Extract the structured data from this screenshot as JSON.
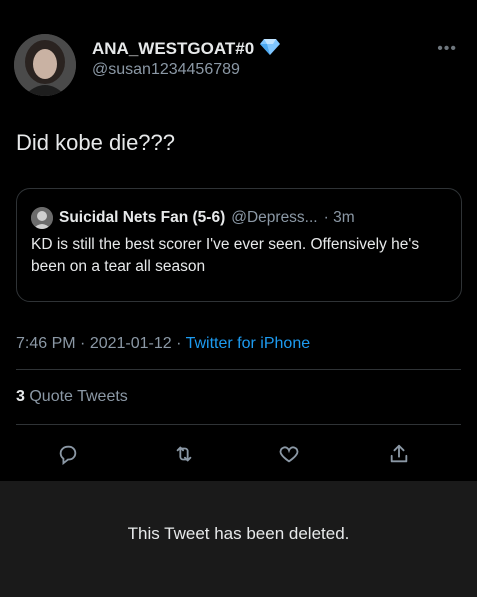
{
  "tweet": {
    "display_name": "ANA_WESTGOAT#0",
    "handle": "@susan1234456789",
    "more_icon": "more-dots-icon",
    "verified_icon": "diamond-icon",
    "text": "Did kobe die???",
    "quoted": {
      "name": "Suicidal Nets Fan (5-6)",
      "handle": "@Depress...",
      "time": "· 3m",
      "body": "KD is still the best scorer I've ever seen. Offensively he's been on a tear all season"
    },
    "meta": {
      "time": "7:46 PM",
      "date": "2021-01-12",
      "source": "Twitter for iPhone"
    },
    "quote_tweets": {
      "count": "3",
      "label": "Quote Tweets"
    }
  },
  "actions": [
    "reply-icon",
    "retweet-icon",
    "like-icon",
    "share-icon"
  ],
  "deleted_notice": "This Tweet has been deleted.",
  "colors": {
    "background": "#000000",
    "link": "#1d9bf0",
    "muted": "#8b98a5",
    "diamond": "#7fc6ff",
    "notice_bar": "#1a1a1a"
  }
}
